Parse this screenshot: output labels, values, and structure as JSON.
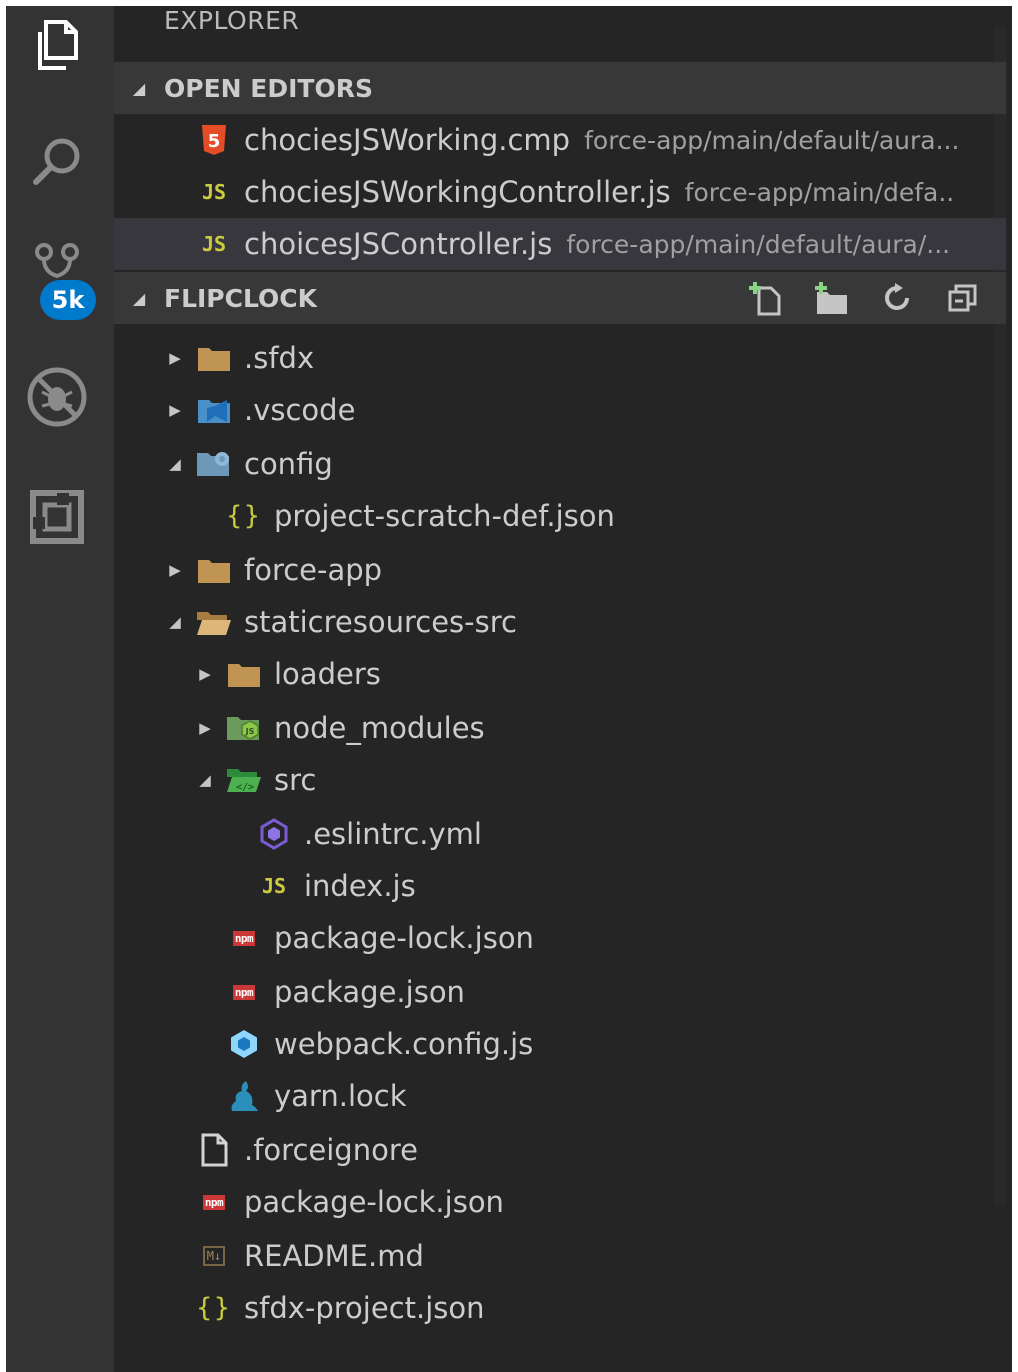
{
  "activity_bar": {
    "badge": "5k"
  },
  "explorer": {
    "title": "EXPLORER",
    "open_editors": {
      "label": "OPEN EDITORS",
      "items": [
        {
          "name": "chociesJSWorking.cmp",
          "path": "force-app/main/default/aura...",
          "icon": "html-icon"
        },
        {
          "name": "chociesJSWorkingController.js",
          "path": "force-app/main/defa..",
          "icon": "js-icon"
        },
        {
          "name": "choicesJSController.js",
          "path": "force-app/main/default/aura/...",
          "icon": "js-icon",
          "selected": true
        }
      ]
    },
    "project": {
      "label": "FLIPCLOCK",
      "tree": [
        {
          "name": ".sfdx",
          "type": "folder",
          "expanded": false,
          "depth": 0,
          "icon": "folder-icon"
        },
        {
          "name": ".vscode",
          "type": "folder",
          "expanded": false,
          "depth": 0,
          "icon": "vscode-folder-icon"
        },
        {
          "name": "config",
          "type": "folder",
          "expanded": true,
          "depth": 0,
          "icon": "config-folder-icon"
        },
        {
          "name": "project-scratch-def.json",
          "type": "file",
          "depth": 1,
          "icon": "json-icon"
        },
        {
          "name": "force-app",
          "type": "folder",
          "expanded": false,
          "depth": 0,
          "icon": "folder-icon"
        },
        {
          "name": "staticresources-src",
          "type": "folder",
          "expanded": true,
          "depth": 0,
          "icon": "folder-open-icon"
        },
        {
          "name": "loaders",
          "type": "folder",
          "expanded": false,
          "depth": 1,
          "icon": "folder-icon"
        },
        {
          "name": "node_modules",
          "type": "folder",
          "expanded": false,
          "depth": 1,
          "icon": "node-folder-icon"
        },
        {
          "name": "src",
          "type": "folder",
          "expanded": true,
          "depth": 1,
          "icon": "src-folder-icon"
        },
        {
          "name": ".eslintrc.yml",
          "type": "file",
          "depth": 2,
          "icon": "eslint-icon"
        },
        {
          "name": "index.js",
          "type": "file",
          "depth": 2,
          "icon": "js-icon"
        },
        {
          "name": "package-lock.json",
          "type": "file",
          "depth": 1,
          "icon": "npm-icon"
        },
        {
          "name": "package.json",
          "type": "file",
          "depth": 1,
          "icon": "npm-icon"
        },
        {
          "name": "webpack.config.js",
          "type": "file",
          "depth": 1,
          "icon": "webpack-icon"
        },
        {
          "name": "yarn.lock",
          "type": "file",
          "depth": 1,
          "icon": "yarn-icon"
        },
        {
          "name": ".forceignore",
          "type": "file",
          "depth": 0,
          "icon": "file-icon"
        },
        {
          "name": "package-lock.json",
          "type": "file",
          "depth": 0,
          "icon": "npm-icon"
        },
        {
          "name": "README.md",
          "type": "file",
          "depth": 0,
          "icon": "markdown-icon"
        },
        {
          "name": "sfdx-project.json",
          "type": "file",
          "depth": 0,
          "icon": "json-icon"
        }
      ]
    }
  },
  "colors": {
    "background": "#252526",
    "activity_bar": "#333333",
    "badge": "#007acc",
    "section_header": "#383838",
    "selection": "#37373d",
    "js_yellow": "#cbcb41"
  }
}
